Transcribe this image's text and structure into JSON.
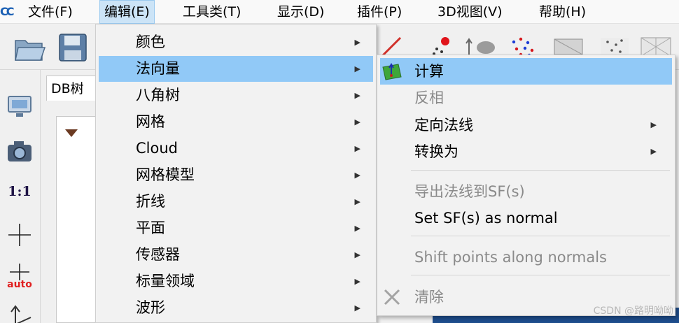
{
  "menubar": {
    "items": [
      {
        "label": "文件(F)"
      },
      {
        "label": "编辑(E)"
      },
      {
        "label": "工具类(T)"
      },
      {
        "label": "显示(D)"
      },
      {
        "label": "插件(P)"
      },
      {
        "label": "3D视图(V)"
      },
      {
        "label": "帮助(H)"
      }
    ],
    "logo_text": "CC"
  },
  "db_panel": {
    "tab_label": "DB树"
  },
  "left_toolbar": {
    "scale_label": "1:1",
    "auto_label": "auto"
  },
  "edit_menu": {
    "items": [
      {
        "label": "颜色"
      },
      {
        "label": "法向量"
      },
      {
        "label": "八角树"
      },
      {
        "label": "网格"
      },
      {
        "label": "Cloud"
      },
      {
        "label": "网格模型"
      },
      {
        "label": "折线"
      },
      {
        "label": "平面"
      },
      {
        "label": "传感器"
      },
      {
        "label": "标量领域"
      },
      {
        "label": "波形"
      }
    ],
    "highlighted": "法向量"
  },
  "normals_submenu": {
    "items": [
      {
        "label": "计算",
        "enabled": true
      },
      {
        "label": "反相",
        "enabled": false
      },
      {
        "label": "定向法线",
        "enabled": true
      },
      {
        "label": "转换为",
        "enabled": true
      },
      {
        "label": "导出法线到SF(s)",
        "enabled": false
      },
      {
        "label": "Set SF(s) as normal",
        "enabled": true
      },
      {
        "label": "Shift points along normals",
        "enabled": false
      },
      {
        "label": "清除",
        "enabled": false
      }
    ],
    "highlighted": "计算"
  },
  "watermark": "CSDN @路明呦呦",
  "colors": {
    "highlight": "#91c9f7",
    "menubar_active": "#cce4f7",
    "view_bg": "#1e4d8c"
  }
}
